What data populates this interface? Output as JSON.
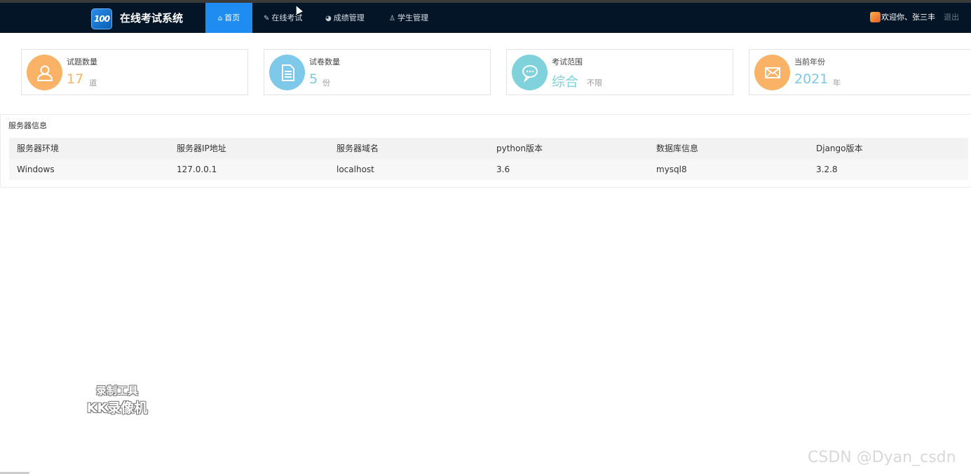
{
  "app": {
    "title": "在线考试系统",
    "logo_text": "100"
  },
  "nav": {
    "items": [
      {
        "label": "首页",
        "icon": "home-icon"
      },
      {
        "label": "在线考试",
        "icon": "edit-icon"
      },
      {
        "label": "成绩管理",
        "icon": "chart-icon"
      },
      {
        "label": "学生管理",
        "icon": "user-icon"
      }
    ],
    "active": "首页"
  },
  "user": {
    "welcome": "欢迎你、张三丰",
    "logout": "退出"
  },
  "stats": [
    {
      "label": "试题数量",
      "value": "17",
      "unit": "道",
      "color": "#f9b266",
      "icon": "user-icon"
    },
    {
      "label": "试卷数量",
      "value": "5",
      "unit": "份",
      "color": "#7ec8ea",
      "icon": "document-icon"
    },
    {
      "label": "考试范围",
      "value": "综合",
      "unit": "不限",
      "color": "#7fd1dc",
      "icon": "chat-icon"
    },
    {
      "label": "当前年份",
      "value": "2021",
      "unit": "年",
      "color": "#f9b266",
      "icon": "mail-icon"
    }
  ],
  "server": {
    "title": "服务器信息",
    "columns": [
      "服务器环境",
      "服务器IP地址",
      "服务器域名",
      "python版本",
      "数据库信息",
      "Django版本"
    ],
    "rows": [
      [
        "Windows",
        "127.0.0.1",
        "localhost",
        "3.6",
        "mysql8",
        "3.2.8"
      ]
    ]
  },
  "overlay": {
    "recorder_line1": "录制工具",
    "recorder_line2": "KK录像机",
    "csdn": "CSDN @Dyan_csdn"
  },
  "colors": {
    "navbar": "#041527",
    "active_nav": "#1e8cf0",
    "orange_value": "#f9b266",
    "blue_value": "#7ec8ea"
  }
}
